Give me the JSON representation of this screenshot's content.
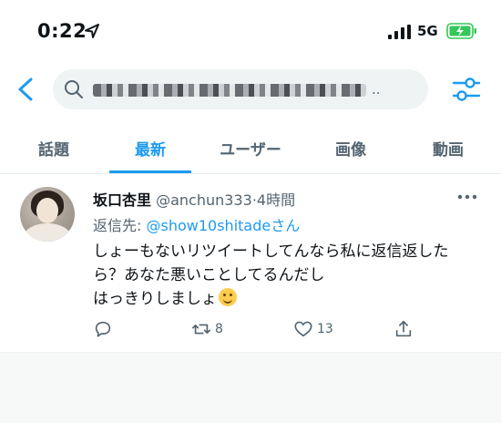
{
  "status_bar": {
    "time": "0:22",
    "network": "5G"
  },
  "search": {
    "query_visible_suffix": "..",
    "query_obscured": true
  },
  "tabs": [
    {
      "label": "話題",
      "active": false
    },
    {
      "label": "最新",
      "active": true
    },
    {
      "label": "ユーザー",
      "active": false
    },
    {
      "label": "画像",
      "active": false
    },
    {
      "label": "動画",
      "active": false
    }
  ],
  "tweet": {
    "display_name": "坂口杏里",
    "handle": "@anchun333",
    "separator": "·",
    "time_ago": "4時間",
    "reply_prefix": "返信先:",
    "reply_to": "@show10shitadeさん",
    "text_lines": [
      "しょーもないリツイートしてんなら私に返信返した",
      "ら？あなた悪いことしてるんだし",
      "はっきりしましょ"
    ],
    "retweets": "8",
    "likes": "13"
  },
  "colors": {
    "accent": "#1d9bf0",
    "muted": "#536471",
    "text": "#0f1419",
    "battery": "#34c759"
  }
}
